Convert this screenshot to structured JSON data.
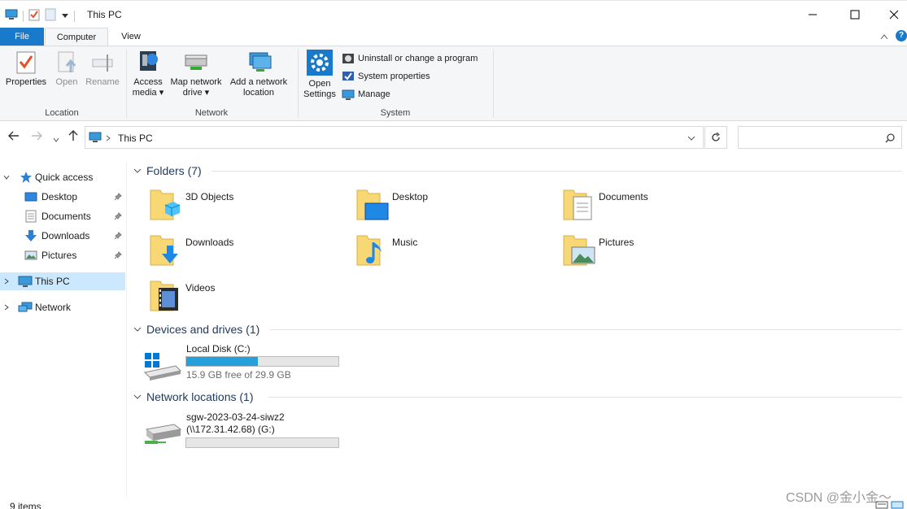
{
  "window": {
    "title": "This PC"
  },
  "ribbon_tabs": {
    "file": "File",
    "computer": "Computer",
    "view": "View"
  },
  "ribbon": {
    "location": {
      "label": "Location",
      "properties": "Properties",
      "open": "Open",
      "rename": "Rename"
    },
    "network": {
      "label": "Network",
      "access_media_1": "Access",
      "access_media_2": "media",
      "map_drive_1": "Map network",
      "map_drive_2": "drive",
      "add_location_1": "Add a network",
      "add_location_2": "location"
    },
    "system": {
      "label": "System",
      "open_settings_1": "Open",
      "open_settings_2": "Settings",
      "uninstall": "Uninstall or change a program",
      "system_properties": "System properties",
      "manage": "Manage"
    }
  },
  "address": {
    "path": "This PC",
    "search_placeholder": ""
  },
  "nav": {
    "quick_access": "Quick access",
    "items": [
      {
        "label": "Desktop",
        "icon": "desktop-icon",
        "pinned": true
      },
      {
        "label": "Documents",
        "icon": "documents-icon",
        "pinned": true
      },
      {
        "label": "Downloads",
        "icon": "downloads-icon",
        "pinned": true
      },
      {
        "label": "Pictures",
        "icon": "pictures-icon",
        "pinned": true
      }
    ],
    "this_pc": "This PC",
    "network": "Network"
  },
  "content": {
    "folders_header": "Folders (7)",
    "folders": [
      {
        "label": "3D Objects",
        "icon": "3d-objects-folder-icon"
      },
      {
        "label": "Desktop",
        "icon": "desktop-folder-icon"
      },
      {
        "label": "Documents",
        "icon": "documents-folder-icon"
      },
      {
        "label": "Downloads",
        "icon": "downloads-folder-icon"
      },
      {
        "label": "Music",
        "icon": "music-folder-icon"
      },
      {
        "label": "Pictures",
        "icon": "pictures-folder-icon"
      },
      {
        "label": "Videos",
        "icon": "videos-folder-icon"
      }
    ],
    "devices_header": "Devices and drives (1)",
    "local_disk": {
      "name": "Local Disk (C:)",
      "free": "15.9 GB free of 29.9 GB",
      "used_fraction": 0.468
    },
    "network_header": "Network locations (1)",
    "network_drive": {
      "name": "sgw-2023-03-24-siwz2",
      "path": "(\\\\172.31.42.68) (G:)",
      "used_fraction": 0
    }
  },
  "status": {
    "items": "9 items"
  },
  "watermark": "CSDN @金小金～",
  "colors": {
    "accent": "#1979ca",
    "selection": "#cce8ff",
    "section_header": "#1e395b",
    "bar_fill": "#26a0da",
    "folder_yellow": "#f8d775"
  }
}
